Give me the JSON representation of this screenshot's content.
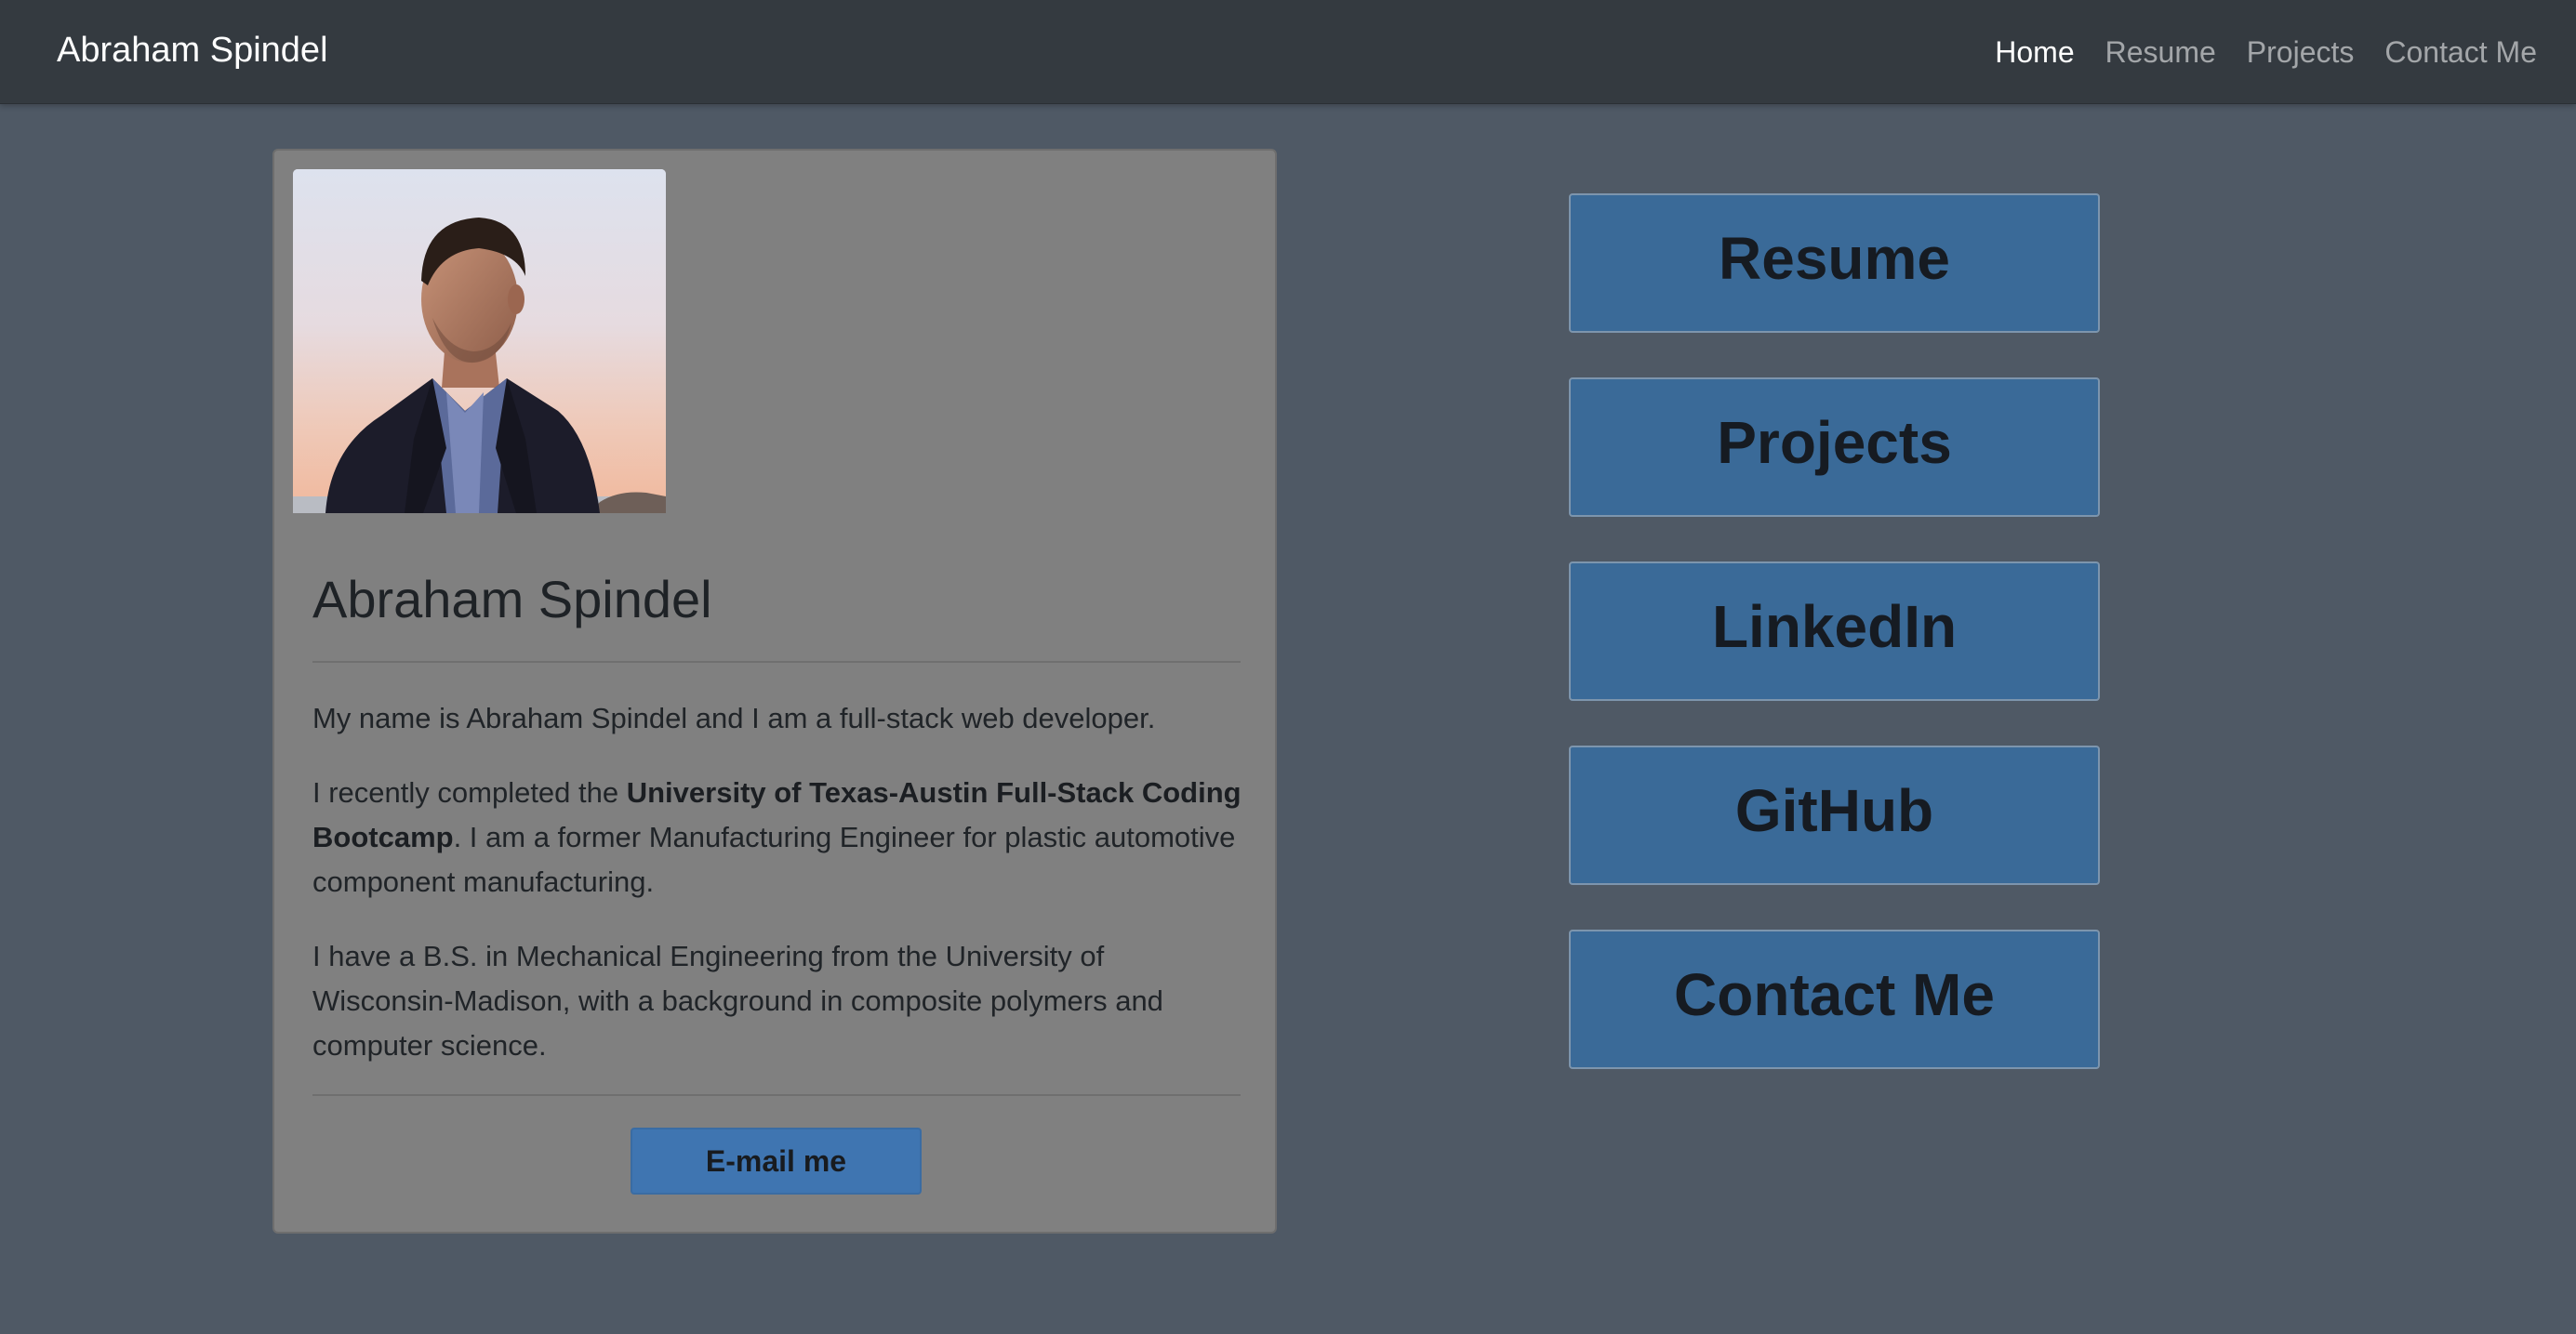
{
  "navbar": {
    "brand": "Abraham Spindel",
    "items": [
      {
        "label": "Home",
        "active": true
      },
      {
        "label": "Resume",
        "active": false
      },
      {
        "label": "Projects",
        "active": false
      },
      {
        "label": "Contact Me",
        "active": false
      }
    ]
  },
  "profile": {
    "name": "Abraham Spindel",
    "intro": "My name is Abraham Spindel and I am a full-stack web developer.",
    "bootcamp_prefix": "I recently completed the ",
    "bootcamp_name": "University of Texas-Austin Full-Stack Coding Bootcamp",
    "bootcamp_suffix": ". I am a former Manufacturing Engineer for plastic automotive component manufacturing.",
    "education": "I have a B.S. in Mechanical Engineering from the University of Wisconsin-Madison, with a background in composite polymers and computer science.",
    "email_button": "E-mail me"
  },
  "links": [
    {
      "label": "Resume"
    },
    {
      "label": "Projects"
    },
    {
      "label": "LinkedIn"
    },
    {
      "label": "GitHub"
    },
    {
      "label": "Contact Me"
    }
  ],
  "colors": {
    "page_background": "#4f5965",
    "navbar": "#343a40",
    "card": "#808080",
    "link_button": "#3a6a98",
    "email_button": "#3f75b1"
  }
}
